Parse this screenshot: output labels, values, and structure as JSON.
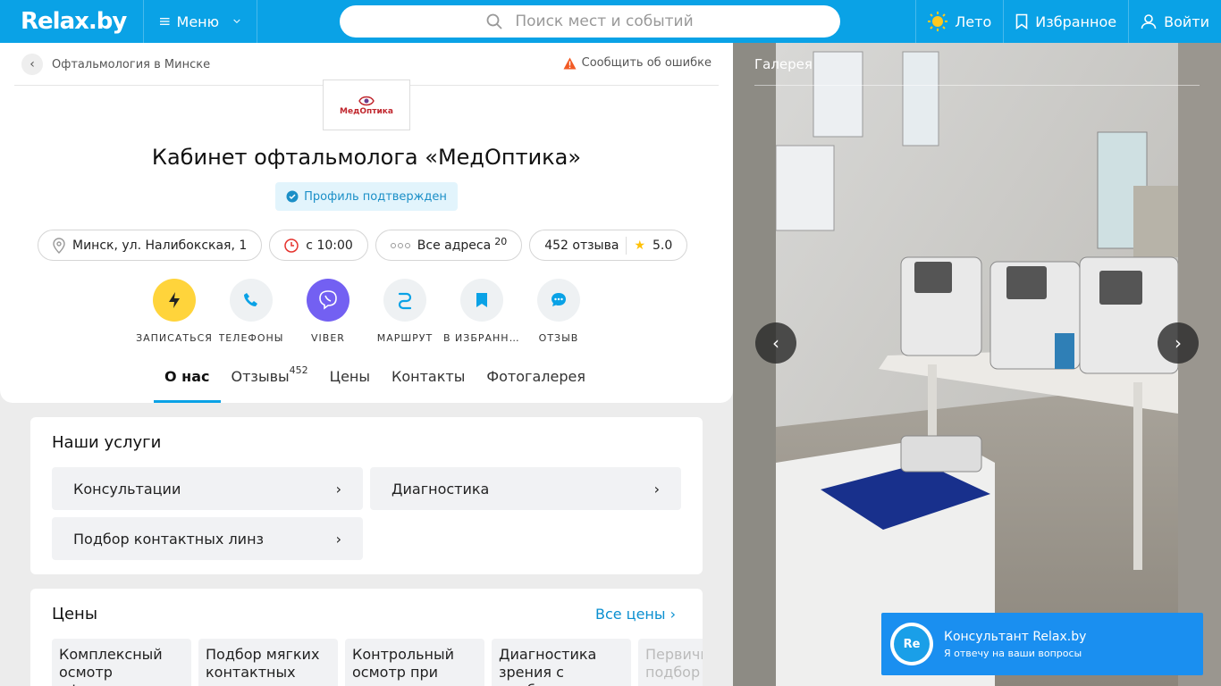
{
  "topbar": {
    "logo": "Relax.by",
    "menu_label": "Меню",
    "search_placeholder": "Поиск мест и событий",
    "season_label": "Лето",
    "favorites_label": "Избранное",
    "login_label": "Войти"
  },
  "breadcrumb": {
    "label": "Офтальмология в Минске"
  },
  "report": {
    "label": "Сообщить об ошибке"
  },
  "place": {
    "logo_text": "МедОптика",
    "title": "Кабинет офтальмолога «МедОптика»",
    "verified": "Профиль подтвержден",
    "address": "Минск, ул. Налибокская, 1",
    "hours": "с 10:00",
    "all_addresses": "Все адреса",
    "addresses_count": "20",
    "reviews": "452 отзыва",
    "rating": "5.0"
  },
  "actions": [
    {
      "label": "ЗАПИСАТЬСЯ",
      "icon": "booking-icon"
    },
    {
      "label": "ТЕЛЕФОНЫ",
      "icon": "phone-icon"
    },
    {
      "label": "VIBER",
      "icon": "viber-icon"
    },
    {
      "label": "МАРШРУТ",
      "icon": "route-icon"
    },
    {
      "label": "В ИЗБРАННОЕ",
      "icon": "bookmark-icon"
    },
    {
      "label": "ОТЗЫВ",
      "icon": "comment-icon"
    }
  ],
  "tabs": [
    {
      "label": "О нас"
    },
    {
      "label": "Отзывы",
      "count": "452"
    },
    {
      "label": "Цены"
    },
    {
      "label": "Контакты"
    },
    {
      "label": "Фотогалерея"
    }
  ],
  "services": {
    "title": "Наши услуги",
    "items": [
      "Консультации",
      "Диагностика",
      "Подбор контактных линз"
    ]
  },
  "prices": {
    "title": "Цены",
    "all_label": "Все цены",
    "items": [
      "Комплексный осмотр офтальмолога",
      "Подбор мягких контактных линз с обучением",
      "Контрольный осмотр при ношении линз",
      "Диагностика зрения с подбором очков",
      "Первичный подбор"
    ]
  },
  "gallery": {
    "title": "Галерея"
  },
  "consultant": {
    "avatar": "Re",
    "name": "Консультант Relax.by",
    "subtitle": "Я отвечу на ваши вопросы"
  },
  "colors": {
    "brand": "#0aa2e6",
    "viber": "#7360f2",
    "booking": "#ffd43b",
    "consultant": "#1a8ff0"
  }
}
